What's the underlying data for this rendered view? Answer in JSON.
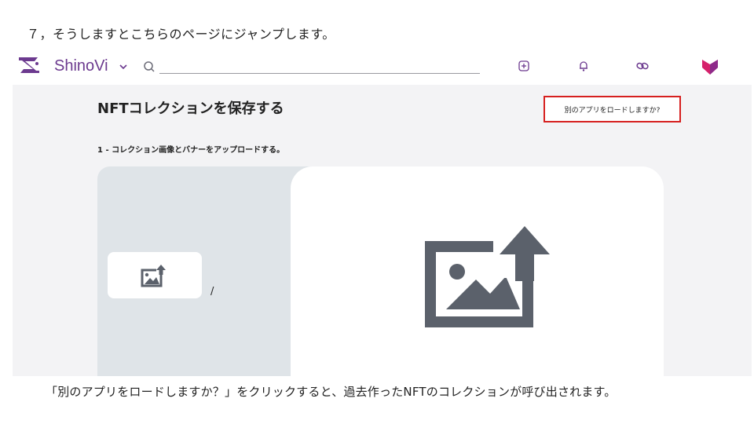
{
  "step_heading": "７，そうしますとこちらのページにジャンプします。",
  "header": {
    "brand_name": "ShinoVi",
    "search": {
      "placeholder": "",
      "value": ""
    },
    "icons": [
      "brand-logo-icon",
      "chevron-down-icon",
      "search-icon",
      "create-plus-icon",
      "bell-icon",
      "link-icon",
      "avatar-shield-icon"
    ],
    "brand_color": "#6c3a8f",
    "accent_color": "#d6216b"
  },
  "main": {
    "title": "NFTコレクションを保存する",
    "load_app_button": "別のアプリをロードしますか?",
    "highlight_color": "#d6201f",
    "step_label": "1 - コレクション画像とバナーをアップロードする。",
    "slash": "/"
  },
  "caption": "「別のアプリをロードしますか？」をクリックすると、過去作ったNFTのコレクションが呼び出されます。"
}
